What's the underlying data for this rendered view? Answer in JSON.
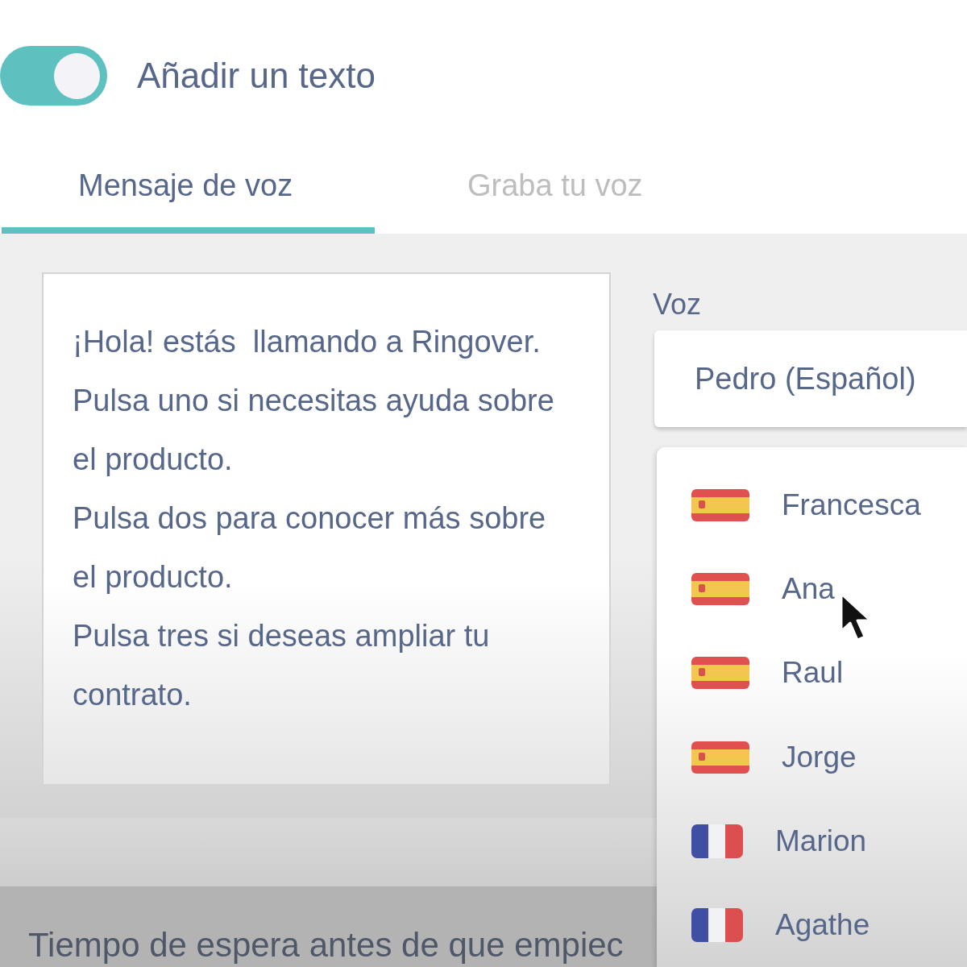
{
  "toggle": {
    "label": "Añadir un texto",
    "on": true
  },
  "tabs": [
    {
      "label": "Mensaje de voz",
      "selected": true
    },
    {
      "label": "Graba tu voz",
      "selected": false
    }
  ],
  "message": {
    "value": "¡Hola! estás  llamando a Ringover.\nPulsa uno si necesitas ayuda sobre el producto.\nPulsa dos para conocer más sobre el producto.\nPulsa tres si deseas ampliar tu contrato."
  },
  "voice": {
    "label": "Voz",
    "value": "Pedro (Español)",
    "options": [
      {
        "name": "Francesca",
        "kind": "spanish"
      },
      {
        "name": "Ana",
        "kind": "spanish"
      },
      {
        "name": "Raul",
        "kind": "spanish"
      },
      {
        "name": "Jorge",
        "kind": "spanish"
      },
      {
        "name": "Marion",
        "kind": "french"
      },
      {
        "name": "Agathe",
        "kind": "french"
      }
    ]
  },
  "next_section": {
    "title": "Tiempo de espera antes de que empiec"
  }
}
